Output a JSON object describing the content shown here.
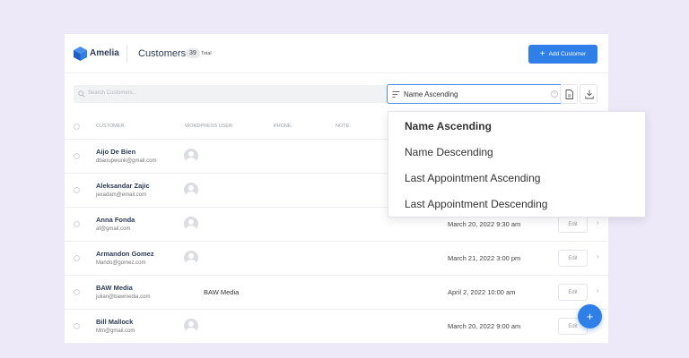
{
  "header": {
    "brand": "Amelia",
    "title": "Customers",
    "count": "39",
    "count_label": "Total",
    "add_button": "Add Customer",
    "brand_color": "#2f7fe8"
  },
  "toolbar": {
    "search_placeholder": "Search Customers...",
    "sort_value": "Name Ascending",
    "export_icon": "document-export-icon",
    "import_icon": "download-icon"
  },
  "table": {
    "columns": [
      "CUSTOMER:",
      "WORDPRESS USER:",
      "PHONE:",
      "NOTE:"
    ],
    "rows": [
      {
        "name": "Aijo De Bien",
        "email": "dbaoupwunk@gmail.com",
        "wp_user": "",
        "appointment": ""
      },
      {
        "name": "Aleksandar Zajic",
        "email": "jexadam@email.com",
        "wp_user": "",
        "appointment": ""
      },
      {
        "name": "Anna Fonda",
        "email": "af@gmail.com",
        "wp_user": "",
        "appointment": "March 20, 2022 9:30 am"
      },
      {
        "name": "Armandon Gomez",
        "email": "Mando@gomez.com",
        "wp_user": "",
        "appointment": "March 21, 2022 3:00 pm"
      },
      {
        "name": "BAW Media",
        "email": "julian@bawmedia.com",
        "wp_user": "BAW Media",
        "appointment": "April 2, 2022 10:00 am"
      },
      {
        "name": "Bill Mallock",
        "email": "Mm@gmail.com",
        "wp_user": "",
        "appointment": "March 20, 2022 9:00 am"
      }
    ],
    "edit_label": "Edit"
  },
  "sort_dropdown": {
    "options": [
      "Name Ascending",
      "Name Descending",
      "Last Appointment Ascending",
      "Last Appointment Descending"
    ],
    "selected": "Name Ascending"
  },
  "fab": {
    "label": "+"
  }
}
